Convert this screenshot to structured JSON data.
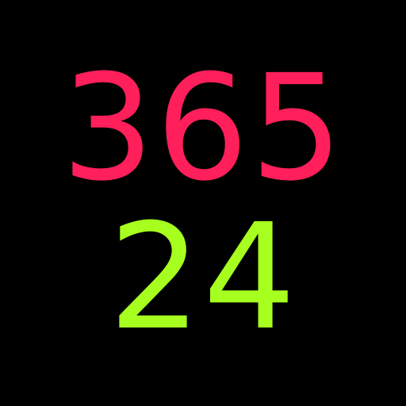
{
  "top_number": {
    "text": "365",
    "color": "#FF1F5A"
  },
  "bottom_number": {
    "text": "24",
    "color": "#A6FF1E"
  },
  "background_color": "#000000"
}
